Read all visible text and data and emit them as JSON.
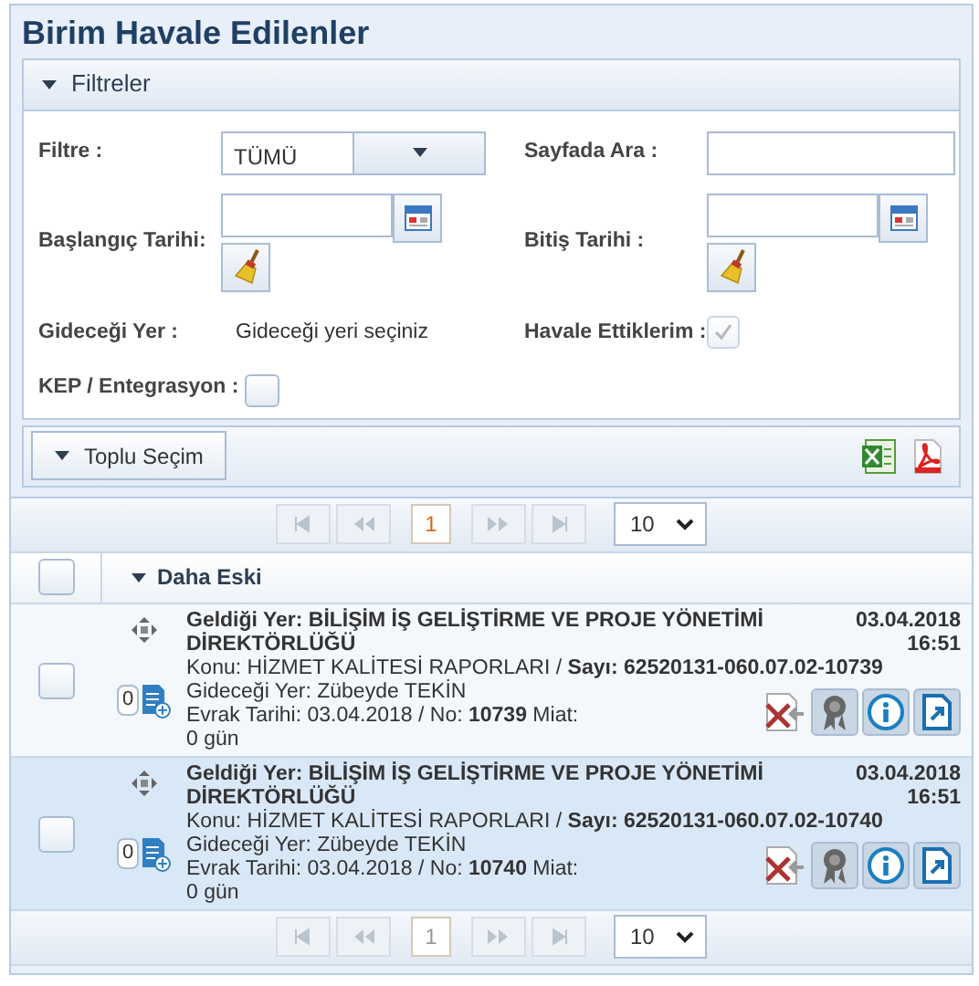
{
  "title": "Birim Havale Edilenler",
  "filters": {
    "header": "Filtreler",
    "expanded": true,
    "filter_label": "Filtre :",
    "filter_value": "TÜMÜ",
    "search_label": "Sayfada Ara :",
    "start_label": "Başlangıç Tarihi:",
    "end_label": "Bitiş Tarihi :",
    "destination_label": "Gideceği Yer :",
    "destination_value": "Gideceği yeri seçiniz",
    "forwarded_label": "Havale Ettiklerim :",
    "forwarded_checked": true,
    "kep_label": "KEP / Entegrasyon :",
    "kep_checked": false
  },
  "toolbar": {
    "bulk_button": "Toplu Seçim"
  },
  "pagers": [
    {
      "page": "1",
      "selected": true,
      "page_size": "10"
    },
    {
      "page": "1",
      "selected": false,
      "page_size": "10"
    }
  ],
  "table": {
    "header_checked": false,
    "group": "Daha Eski",
    "rows": [
      {
        "checked": false,
        "selected": false,
        "count": "0",
        "origin": "Geldiği Yer: BİLİŞİM İŞ GELİŞTİRME VE PROJE YÖNETİMİ DİREKTÖRLÜĞÜ",
        "subject": "Konu: HİZMET KALİTESİ RAPORLARI / **Sayı: 62520131-060.07.02-10739**",
        "destination": "Gideceği Yer: Zübeyde TEKİN",
        "doc": "Evrak Tarihi: 03.04.2018 / No: **10739** Miat:",
        "due": "0 gün",
        "date": "03.04.2018",
        "time": "16:51"
      },
      {
        "checked": false,
        "selected": true,
        "count": "0",
        "origin": "Geldiği Yer: BİLİŞİM İŞ GELİŞTİRME VE PROJE YÖNETİMİ DİREKTÖRLÜĞÜ",
        "subject": "Konu: HİZMET KALİTESİ RAPORLARI / **Sayı: 62520131-060.07.02-10740**",
        "destination": "Gideceği Yer: Zübeyde TEKİN",
        "doc": "Evrak Tarihi: 03.04.2018 / No: **10740** Miat:",
        "due": "0 gün",
        "date": "03.04.2018",
        "time": "16:51"
      }
    ]
  }
}
